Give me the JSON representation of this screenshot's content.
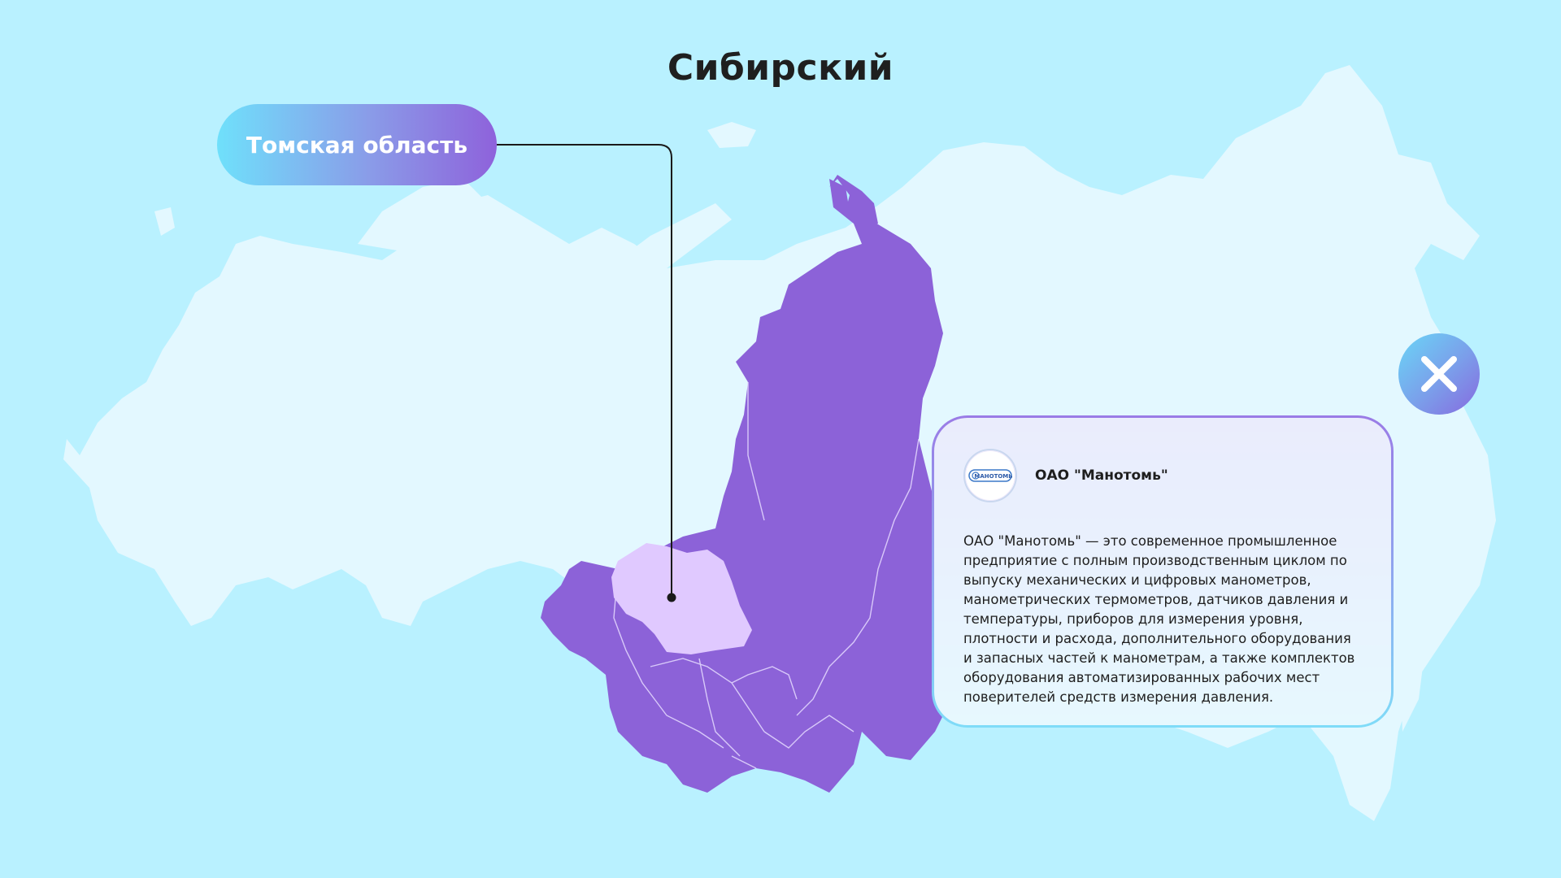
{
  "title": "Сибирский",
  "selected_region": {
    "label": "Томская область"
  },
  "close_button": {
    "icon": "close-icon"
  },
  "company": {
    "logo_text": "МАНОТОМЬ",
    "name": "ОАО \"Манотомь\"",
    "description": "ОАО \"Манотомь\" — это современное промышленное предприятие с полным производственным циклом по выпуску механических и цифровых манометров, манометрических термометров, датчиков давления и температуры, приборов для измерения уровня, плотности и расхода, дополнительного оборудования и запасных частей к манометрам, а также комплектов оборудования автоматизированных рабочих мест поверителей средств измерения давления."
  },
  "colors": {
    "background": "#b9f1ff",
    "russia_land": "#e3f8ff",
    "district_fill": "#8c62d8",
    "highlight_region": "#e0c9ff",
    "pill_gradient_start": "#6fe0fb",
    "pill_gradient_end": "#8e62db",
    "title_text": "#1f1f1f"
  }
}
